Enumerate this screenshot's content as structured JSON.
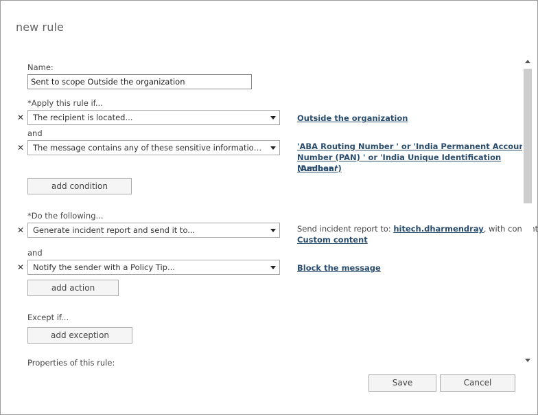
{
  "dialog": {
    "title": "new rule"
  },
  "name": {
    "label": "Name:",
    "value": "Sent to scope Outside the organization"
  },
  "apply": {
    "label": "*Apply this rule if...",
    "and_label": "and",
    "condition1": {
      "value": "The recipient is located...",
      "detail_link": "Outside the organization"
    },
    "condition2": {
      "value": "The message contains any of these sensitive information types...",
      "detail_link_lines": [
        "'ABA Routing Number ' or 'India Permanent Account",
        "Number (PAN) ' or 'India Unique Identification (Aadhaar)",
        "Number '"
      ]
    },
    "add_button": "add condition"
  },
  "actions": {
    "label": "*Do the following...",
    "and_label": "and",
    "action1": {
      "value": "Generate incident report and send it to...",
      "detail_prefix": "Send incident report to:",
      "detail_user_link": "hitech.dharmendray",
      "detail_middle": ", with content:",
      "detail_content_link": "Custom content"
    },
    "action2": {
      "value": "Notify the sender with a Policy Tip...",
      "detail_link": "Block the message"
    },
    "add_button": "add action"
  },
  "exceptions": {
    "label": "Except if...",
    "add_button": "add exception"
  },
  "properties": {
    "label": "Properties of this rule:"
  },
  "footer": {
    "save_label": "Save",
    "cancel_label": "Cancel"
  }
}
